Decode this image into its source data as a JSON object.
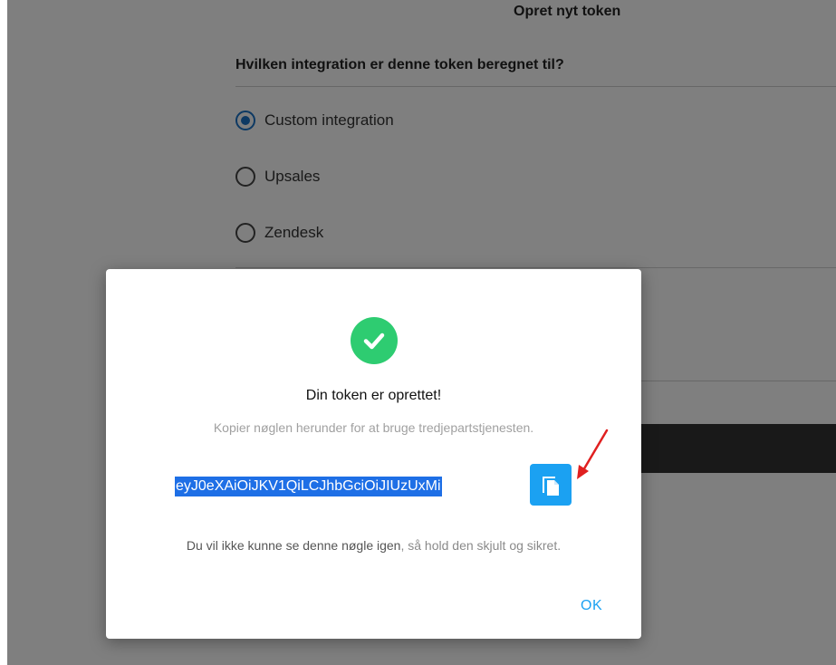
{
  "background": {
    "title": "Opret nyt token",
    "question": "Hvilken integration er denne token beregnet til?",
    "options": [
      {
        "label": "Custom integration",
        "selected": true
      },
      {
        "label": "Upsales",
        "selected": false
      },
      {
        "label": "Zendesk",
        "selected": false
      }
    ],
    "hidden_fragment": ")"
  },
  "modal": {
    "title": "Din token er oprettet!",
    "subtitle": "Kopier nøglen herunder for at bruge tredjepartstjenesten.",
    "token": "eyJ0eXAiOiJKV1QiLCJhbGciOiJIUzUxMi",
    "warning_emph": "Du vil ikke kunne se denne nøgle igen",
    "warning_rest": ", så hold den skjult og sikret.",
    "ok_label": "OK"
  },
  "icons": {
    "success": "check-circle-icon",
    "copy": "copy-icon",
    "annotation": "red-arrow"
  },
  "colors": {
    "accent": "#1ba1f2",
    "success": "#2ecc71",
    "selection": "#1e6fe6",
    "radio_selected": "#1a73c6",
    "annotation_arrow": "#e02020"
  }
}
